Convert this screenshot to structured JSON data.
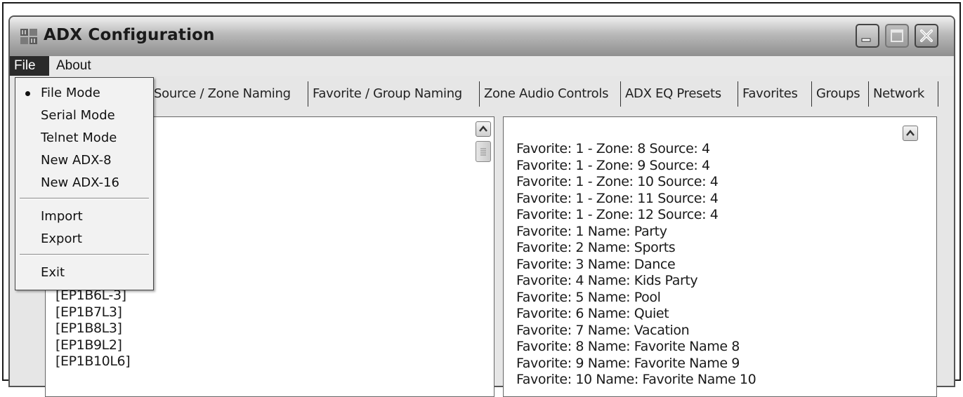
{
  "window": {
    "title": "ADX Configuration"
  },
  "menubar": {
    "file": "File",
    "about": "About"
  },
  "file_menu": {
    "items": [
      {
        "label": "File Mode",
        "selected": true
      },
      {
        "label": "Serial Mode"
      },
      {
        "label": "Telnet Mode"
      },
      {
        "label": "New ADX-8"
      },
      {
        "label": "New ADX-16"
      },
      {
        "label": "Import"
      },
      {
        "label": "Export"
      },
      {
        "label": "Exit"
      }
    ]
  },
  "tabs": [
    "Source / Zone Naming",
    "Favorite / Group Naming",
    "Zone Audio Controls",
    "ADX EQ Presets",
    "Favorites",
    "Groups",
    "Network"
  ],
  "left_list": [
    "[EP1B6L-3]",
    "[EP1B7L3]",
    "[EP1B8L3]",
    "[EP1B9L2]",
    "[EP1B10L6]"
  ],
  "right_list": [
    "Favorite: 1 - Zone: 8 Source: 4",
    "Favorite: 1 - Zone: 9 Source: 4",
    "Favorite: 1 - Zone: 10 Source: 4",
    "Favorite: 1 - Zone: 11 Source: 4",
    "Favorite: 1 - Zone: 12 Source: 4",
    "Favorite: 1 Name: Party",
    "Favorite: 2 Name: Sports",
    "Favorite: 3 Name: Dance",
    "Favorite: 4 Name: Kids Party",
    "Favorite: 5 Name: Pool",
    "Favorite: 6 Name: Quiet",
    "Favorite: 7 Name: Vacation",
    "Favorite: 8 Name: Favorite Name 8",
    "Favorite: 9 Name: Favorite Name 9",
    "Favorite: 10 Name: Favorite Name 10"
  ]
}
